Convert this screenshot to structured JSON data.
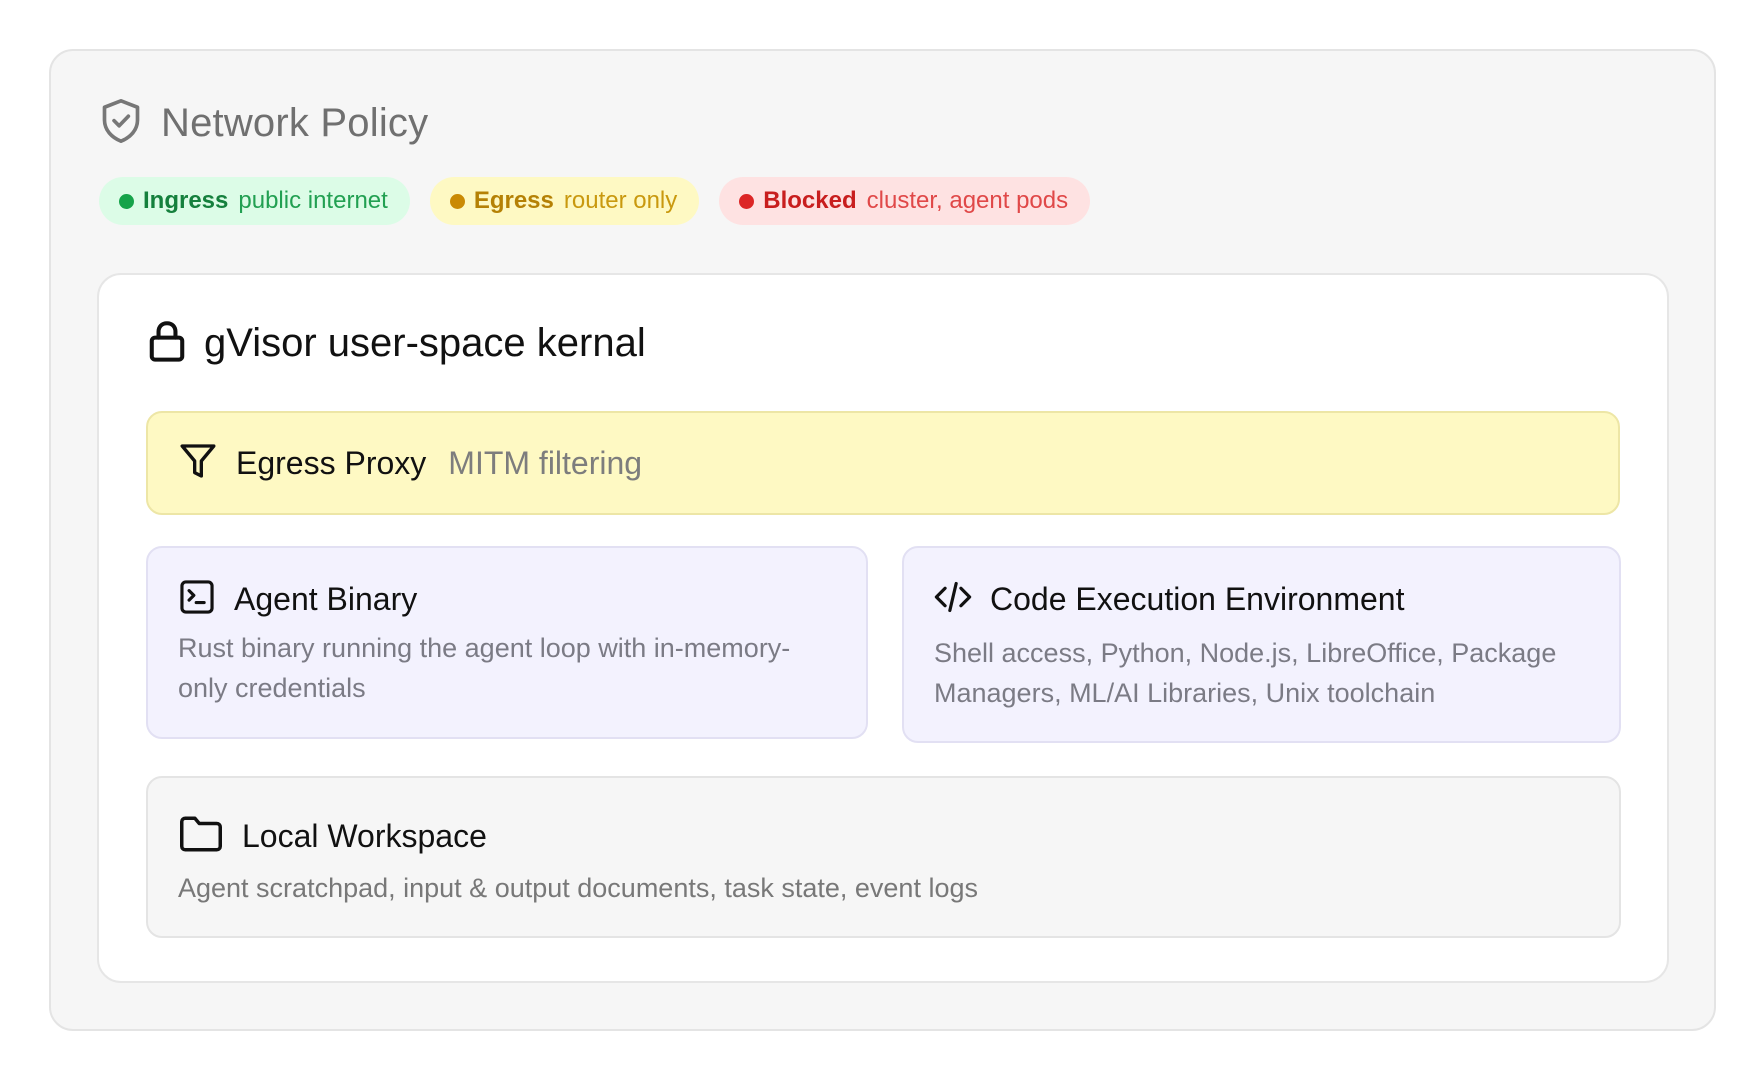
{
  "header": {
    "title": "Network Policy",
    "icon": "shield-check-icon"
  },
  "pills": {
    "ingress": {
      "key": "Ingress",
      "value": "public internet",
      "color": "#16a34a"
    },
    "egress": {
      "key": "Egress",
      "value": "router only",
      "color": "#ca8a04"
    },
    "blocked": {
      "key": "Blocked",
      "value": "cluster, agent pods",
      "color": "#dc2626"
    }
  },
  "sandbox": {
    "title": "gVisor user-space kernal",
    "icon": "lock-icon"
  },
  "egress_proxy": {
    "name": "Egress Proxy",
    "desc": "MITM filtering",
    "icon": "filter-icon"
  },
  "agent_binary": {
    "name": "Agent Binary",
    "desc": "Rust binary running the agent loop with in-memory-only credentials",
    "icon": "terminal-icon"
  },
  "code_env": {
    "name": "Code Execution Environment",
    "desc": "Shell access, Python, Node.js, LibreOffice, Package Managers, ML/AI Libraries, Unix toolchain",
    "icon": "code-icon"
  },
  "workspace": {
    "name": "Local Workspace",
    "desc": "Agent scratchpad, input & output documents, task state, event logs",
    "icon": "folder-icon"
  }
}
